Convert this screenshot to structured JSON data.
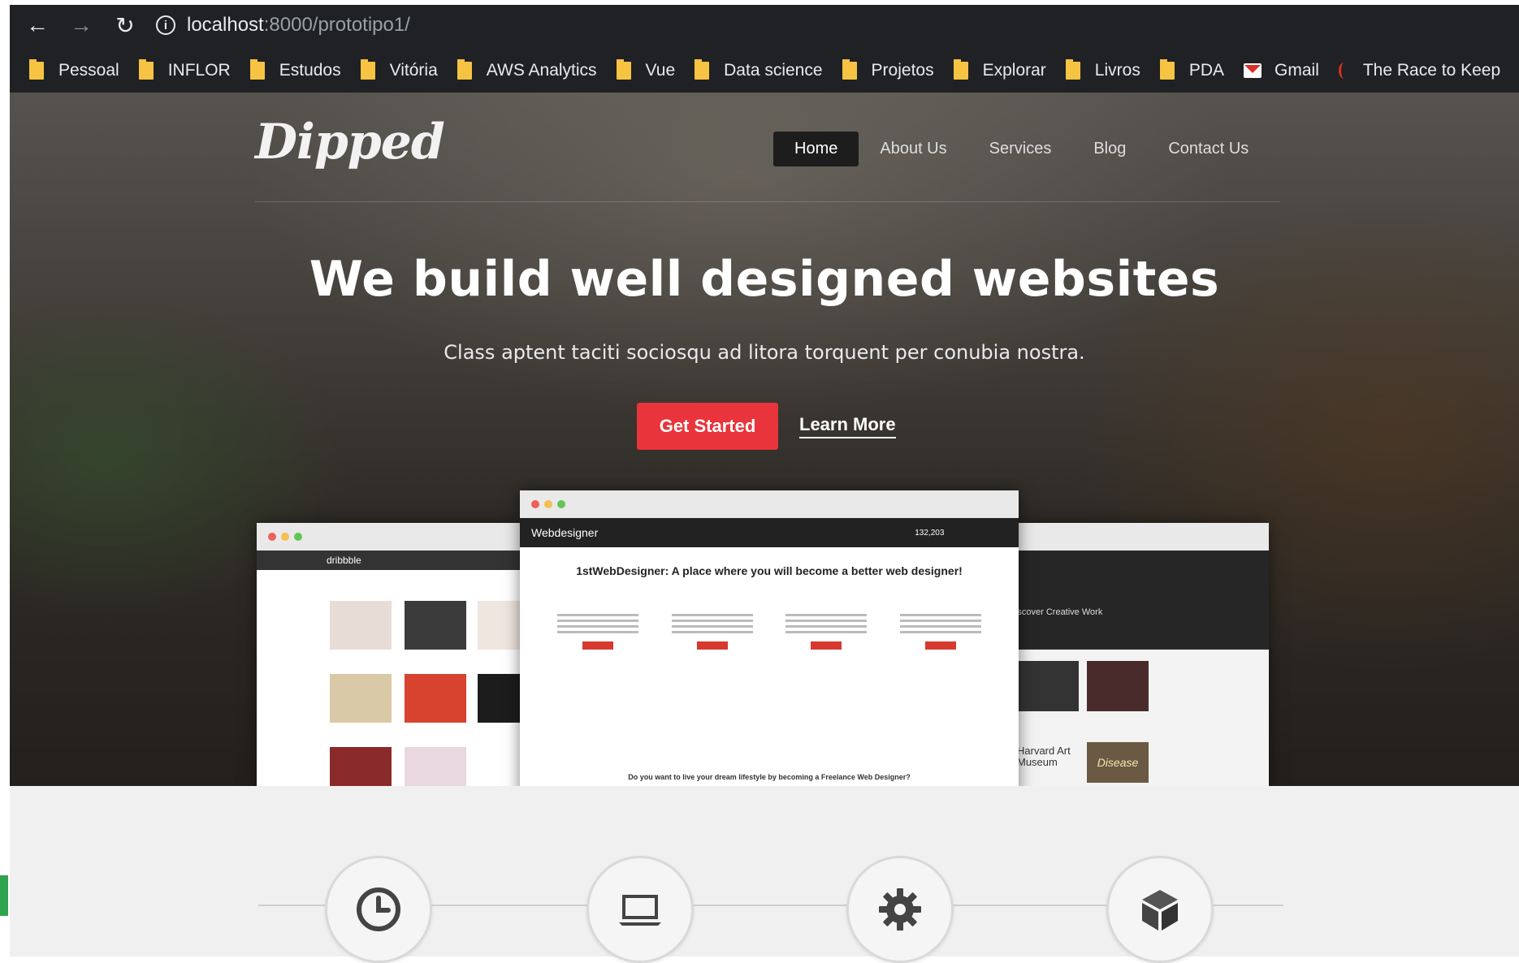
{
  "browser": {
    "url_host": "localhost",
    "url_path": ":8000/prototipo1/",
    "bookmarks": [
      "Pessoal",
      "INFLOR",
      "Estudos",
      "Vitória",
      "AWS Analytics",
      "Vue",
      "Data science",
      "Projetos",
      "Explorar",
      "Livros",
      "PDA",
      "Gmail",
      "The Race to Keep"
    ]
  },
  "site": {
    "logo": "Dipped",
    "nav": [
      "Home",
      "About Us",
      "Services",
      "Blog",
      "Contact Us"
    ],
    "headline": "We build well designed websites",
    "subheadline": "Class aptent taciti sociosqu ad litora torquent per conubia nostra.",
    "cta_primary": "Get Started",
    "cta_secondary": "Learn More"
  },
  "mockups": {
    "left_brand": "dribbble",
    "center_brand": "Webdesigner",
    "center_count": "132,203",
    "center_title": "1stWebDesigner: A place where you will become a better web designer!",
    "center_footer": "Do you want to live your dream lifestyle by becoming a Freelance Web Designer?",
    "right_heading": "Discover Creative Work",
    "right_tiles": [
      "Harvard Art Museum",
      "Disease"
    ]
  },
  "features": {
    "icons": [
      "clock-icon",
      "laptop-icon",
      "gear-icon",
      "cube-icon"
    ]
  }
}
